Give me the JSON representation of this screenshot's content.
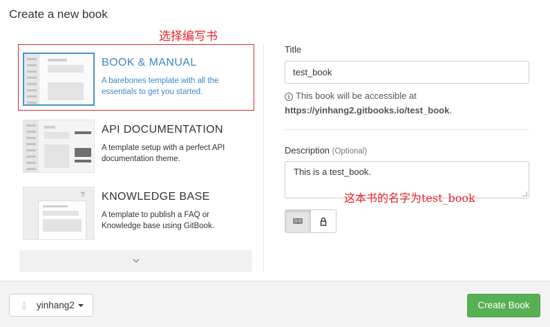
{
  "page": {
    "title": "Create a new book"
  },
  "annotations": {
    "choose": "选择编写书",
    "name_note": "这本书的名字为test_book"
  },
  "templates": [
    {
      "title": "BOOK & MANUAL",
      "description": "A barebones template with all the essentials to get you started.",
      "selected": true
    },
    {
      "title": "API DOCUMENTATION",
      "description": "A template setup with a perfect API documentation theme.",
      "selected": false
    },
    {
      "title": "KNOWLEDGE BASE",
      "description": "A template to publish a FAQ or Knowledge base using GitBook.",
      "selected": false
    }
  ],
  "more": {
    "icon": "chevron-down-icon"
  },
  "form": {
    "title_label": "Title",
    "title_value": "test_book",
    "info_prefix": "This book will be accessible at",
    "info_url": "https://yinhang2.gitbooks.io/test_book",
    "info_suffix": ".",
    "description_label": "Description",
    "description_optional": "(Optional)",
    "description_value": "This is a test_book.",
    "visibility": {
      "options": [
        "public-book-icon",
        "private-lock-icon"
      ],
      "selected": "public-book-icon"
    }
  },
  "footer": {
    "user": "yinhang2",
    "create_label": "Create Book"
  },
  "colors": {
    "accent": "#3e87c3",
    "create": "#58b054",
    "annotation": "#e8222a"
  }
}
